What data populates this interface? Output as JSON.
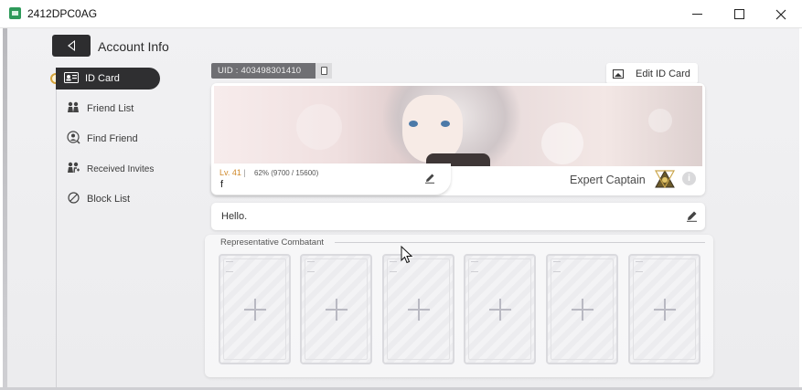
{
  "window": {
    "title": "2412DPC0AG",
    "controls": [
      "minimize",
      "maximize",
      "close"
    ]
  },
  "header": {
    "title": "Account Info"
  },
  "sidebar": {
    "items": [
      {
        "label": "ID Card",
        "icon": "id-card-icon",
        "active": true
      },
      {
        "label": "Friend List",
        "icon": "friends-icon"
      },
      {
        "label": "Find Friend",
        "icon": "find-friend-icon"
      },
      {
        "label": "Received Invites",
        "icon": "invites-icon"
      },
      {
        "label": "Block List",
        "icon": "block-icon"
      }
    ]
  },
  "profile": {
    "uid": "UID : 403498301410",
    "edit_card_label": "Edit ID Card",
    "level": "Lv. 41",
    "exp_percent": "62%",
    "exp_detail": "(9700 / 15600)",
    "name": "f",
    "rank": "Expert Captain",
    "greeting": "Hello."
  },
  "combatants": {
    "title": "Representative Combatant",
    "slots": [
      "empty",
      "empty",
      "empty",
      "empty",
      "empty",
      "empty"
    ]
  },
  "colors": {
    "accent_dark": "#2f2f31",
    "level_orange": "#d08a2c",
    "uid_bg": "#6f6f73"
  }
}
